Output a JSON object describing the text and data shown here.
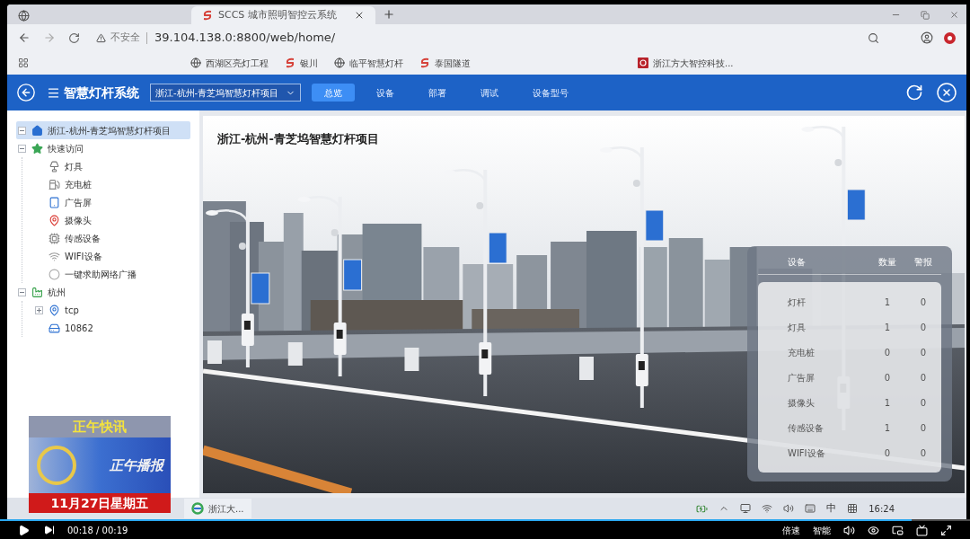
{
  "browser": {
    "tabs": [
      {
        "selected": false
      },
      {
        "title": "SCCS 城市照明智控云系统",
        "selected": true
      }
    ],
    "security_label": "不安全",
    "url": "39.104.138.0:8800/web/home/",
    "bookmarks": [
      {
        "kind": "globe",
        "label": "西湖区亮灯工程"
      },
      {
        "kind": "swirl",
        "label": "银川"
      },
      {
        "kind": "globe",
        "label": "临平智慧灯杆"
      },
      {
        "kind": "swirl",
        "label": "泰国隧道"
      },
      {
        "kind": "square",
        "label": "浙江方大智控科技..."
      }
    ]
  },
  "app_header": {
    "title": "智慧灯杆系统",
    "project_select": {
      "value": "浙江-杭州-青芝坞智慧灯杆项目"
    },
    "nav": [
      {
        "label": "总览",
        "selected": true
      },
      {
        "label": "设备",
        "selected": false
      },
      {
        "label": "部署",
        "selected": false
      },
      {
        "label": "调试",
        "selected": false
      },
      {
        "label": "设备型号",
        "selected": false
      }
    ]
  },
  "sidebar": {
    "tree": [
      {
        "kind": "home",
        "label": "浙江-杭州-青芝坞智慧灯杆项目",
        "selected": true,
        "expanded": true
      },
      {
        "kind": "star",
        "label": "快速访问",
        "selected": false,
        "expanded": true,
        "children": [
          {
            "kind": "lamp",
            "label": "灯具",
            "selected": false
          },
          {
            "kind": "charger",
            "label": "充电桩",
            "selected": false
          },
          {
            "kind": "screen",
            "label": "广告屏",
            "selected": false
          },
          {
            "kind": "camera",
            "label": "摄像头",
            "selected": false
          },
          {
            "kind": "sensor",
            "label": "传感设备",
            "selected": false
          },
          {
            "kind": "wifi",
            "label": "WIFI设备",
            "selected": false
          },
          {
            "kind": "broadcast",
            "label": "一键求助网络广播",
            "selected": false
          }
        ]
      },
      {
        "kind": "city",
        "label": "杭州",
        "selected": false,
        "expanded": true,
        "children": [
          {
            "kind": "pin",
            "label": "tcp",
            "selected": false,
            "expanded": false
          },
          {
            "kind": "device",
            "label": "10862",
            "selected": false
          }
        ]
      }
    ]
  },
  "main": {
    "title": "浙江-杭州-青芝坞智慧灯杆项目",
    "device_panel": {
      "columns": [
        "设备",
        "数量",
        "警报"
      ],
      "rows": [
        [
          "灯杆",
          "1",
          "0"
        ],
        [
          "灯具",
          "1",
          "0"
        ],
        [
          "充电桩",
          "0",
          "0"
        ],
        [
          "广告屏",
          "0",
          "0"
        ],
        [
          "摄像头",
          "1",
          "0"
        ],
        [
          "传感设备",
          "1",
          "0"
        ],
        [
          "WIFI设备",
          "0",
          "0"
        ]
      ]
    }
  },
  "taskbar": {
    "items": [
      {
        "label": "浙江大..."
      }
    ],
    "input_method": "中",
    "time": "16:24"
  },
  "player": {
    "progress": {
      "level": 0.94
    },
    "time": "00:18 / 00:19",
    "buttons": [
      "倍速",
      "智能"
    ]
  },
  "news_overlay": {
    "title": "正午快讯",
    "logo_text": "正午播报",
    "date": "11月27日星期五"
  }
}
